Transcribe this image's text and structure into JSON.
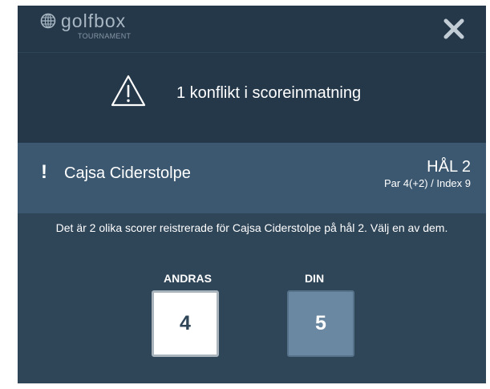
{
  "header": {
    "logo_text": "golfbox",
    "logo_subtitle": "TOURNAMENT",
    "close_icon": "close-icon"
  },
  "conflict": {
    "icon": "warning-triangle-icon",
    "text": "1 konflikt i scoreinmatning"
  },
  "player": {
    "icon": "exclamation-icon",
    "marker": "!",
    "name": "Cajsa Ciderstolpe",
    "hole_title": "HÅL 2",
    "hole_info": "Par 4(+2) / Index 9"
  },
  "message": "Det är 2 olika scorer reistrerade för Cajsa Ciderstolpe på hål 2. Välj en av dem.",
  "choices": {
    "others_label": "ANDRAS",
    "others_score": "4",
    "mine_label": "DIN",
    "mine_score": "5"
  },
  "colors": {
    "background": "#2f4558",
    "header": "#24384a",
    "player_band": "#3c5870",
    "mine_box": "#6a88a1"
  }
}
